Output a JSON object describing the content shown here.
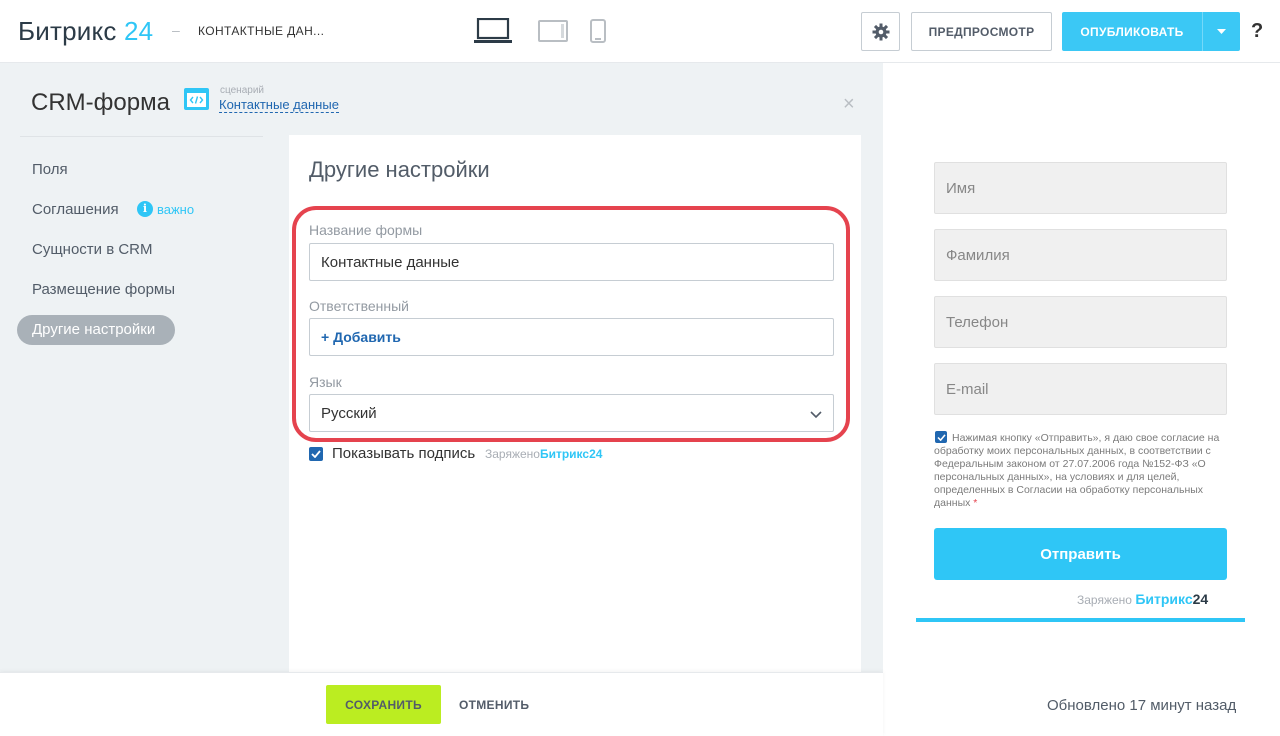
{
  "header": {
    "logo_text": "Битрикс",
    "logo_num": "24",
    "separator": "–",
    "breadcrumb": "КОНТАКТНЫЕ ДАН...",
    "preview_label": "ПРЕДПРОСМОТР",
    "publish_label": "ОПУБЛИКОВАТЬ",
    "help_label": "?"
  },
  "panel": {
    "title": "CRM-форма",
    "scenario_label": "сценарий",
    "scenario_link": "Контактные данные",
    "close_label": "×"
  },
  "nav": {
    "items": [
      {
        "label": "Поля"
      },
      {
        "label": "Соглашения"
      },
      {
        "label": "Сущности в CRM"
      },
      {
        "label": "Размещение формы"
      },
      {
        "label": "Другие настройки"
      }
    ],
    "info_badge": "i",
    "important_label": "важно"
  },
  "card": {
    "title": "Другие настройки",
    "form_name_label": "Название формы",
    "form_name_value": "Контактные данные",
    "responsible_label": "Ответственный",
    "add_label": "+ Добавить",
    "language_label": "Язык",
    "language_value": "Русский",
    "show_signature_label": "Показывать подпись",
    "signature_prefix": "Заряжено",
    "signature_brand": "Битрикс24"
  },
  "footer": {
    "save_label": "СОХРАНИТЬ",
    "cancel_label": "ОТМЕНИТЬ"
  },
  "preview": {
    "fields": [
      {
        "placeholder": "Имя"
      },
      {
        "placeholder": "Фамилия"
      },
      {
        "placeholder": "Телефон"
      },
      {
        "placeholder": "E-mail"
      }
    ],
    "consent_text": "Нажимая кнопку «Отправить», я даю свое согласие на обработку моих персональных данных, в соответствии с Федеральным законом от 27.07.2006 года №152-ФЗ «О персональных данных», на условиях и для целей, определенных в Согласии на обработку персональных данных",
    "consent_star": "*",
    "send_label": "Отправить",
    "brand_prefix": "Заряжено",
    "brand_name": "Битрикс",
    "brand_num": "24",
    "updated_text": "Обновлено 17 минут назад"
  },
  "colors": {
    "accent": "#2fc6f6",
    "save": "#bbed21",
    "highlight": "#e5434e",
    "link": "#2067b0"
  }
}
